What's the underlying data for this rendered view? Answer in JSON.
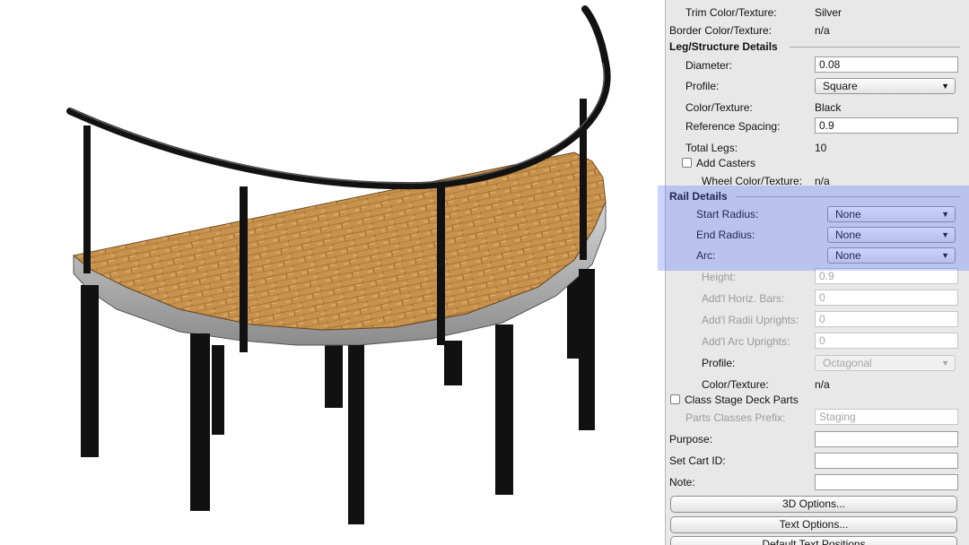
{
  "properties": {
    "trim_color": {
      "label": "Trim Color/Texture:",
      "value": "Silver"
    },
    "border_color": {
      "label": "Border Color/Texture:",
      "value": "n/a"
    },
    "leg_section": "Leg/Structure Details",
    "diameter": {
      "label": "Diameter:",
      "value": "0.08"
    },
    "profile": {
      "label": "Profile:",
      "value": "Square"
    },
    "leg_color": {
      "label": "Color/Texture:",
      "value": "Black"
    },
    "reference_spacing": {
      "label": "Reference Spacing:",
      "value": "0.9"
    },
    "total_legs": {
      "label": "Total Legs:",
      "value": "10"
    },
    "add_casters": {
      "label": "Add Casters",
      "checked": false
    },
    "wheel_color": {
      "label": "Wheel Color/Texture:",
      "value": "n/a"
    },
    "rail_section": "Rail Details",
    "start_radius": {
      "label": "Start Radius:",
      "value": "None"
    },
    "end_radius": {
      "label": "End Radius:",
      "value": "None"
    },
    "arc": {
      "label": "Arc:",
      "value": "None"
    },
    "height": {
      "label": "Height:",
      "value": "0.9"
    },
    "horiz_bars": {
      "label": "Add'l Horiz. Bars:",
      "value": "0"
    },
    "radii_uprights": {
      "label": "Add'l Radii Uprights:",
      "value": "0"
    },
    "arc_uprights": {
      "label": "Add'l Arc Uprights:",
      "value": "0"
    },
    "rail_profile": {
      "label": "Profile:",
      "value": "Octagonal"
    },
    "rail_color": {
      "label": "Color/Texture:",
      "value": "n/a"
    },
    "class_parts": {
      "label": "Class Stage Deck Parts",
      "checked": false
    },
    "parts_prefix": {
      "label": "Parts Classes Prefix:",
      "value": "Staging"
    },
    "purpose": {
      "label": "Purpose:",
      "value": ""
    },
    "cart_id": {
      "label": "Set Cart ID:",
      "value": ""
    },
    "note": {
      "label": "Note:",
      "value": ""
    }
  },
  "buttons": {
    "options_3d": "3D Options...",
    "text_options": "Text Options...",
    "default_text": "Default Text Positions"
  },
  "colors": {
    "highlight": "#4460ff",
    "deck_wood": "#c8924c",
    "deck_edge": "#a8a8a8",
    "rail": "#1a1a1a",
    "panel_bg": "#e8e8e8"
  }
}
